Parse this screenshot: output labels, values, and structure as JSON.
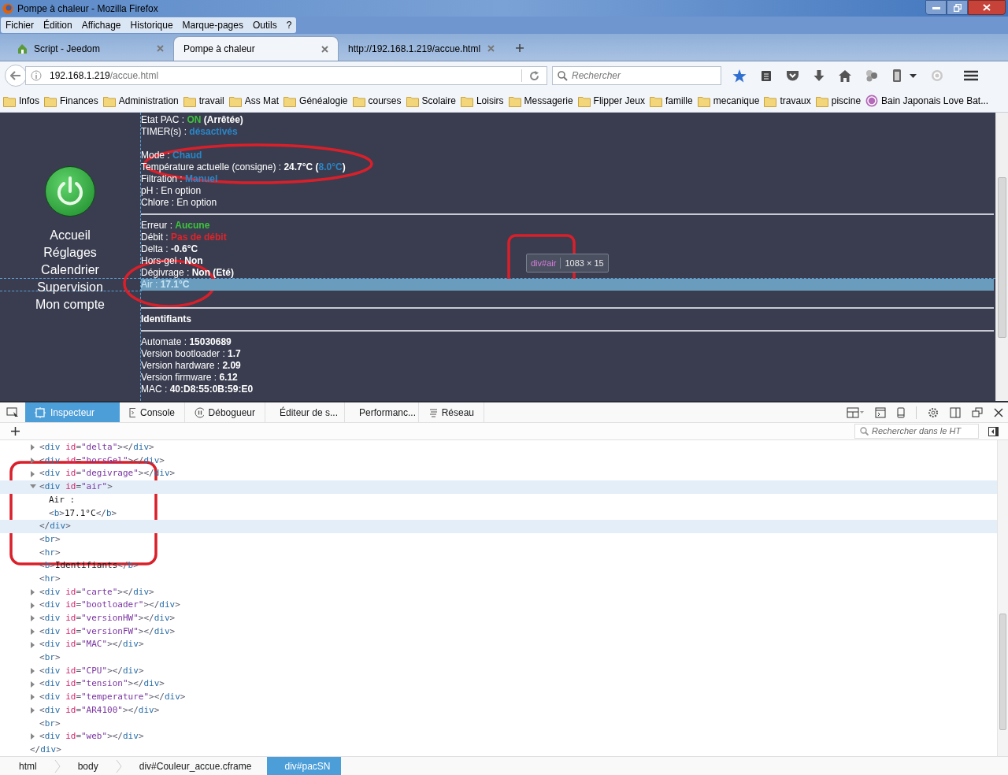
{
  "window": {
    "title": "Pompe à chaleur - Mozilla Firefox"
  },
  "menu": [
    "Fichier",
    "Édition",
    "Affichage",
    "Historique",
    "Marque-pages",
    "Outils",
    "?"
  ],
  "tabs": [
    {
      "label": "Script - Jeedom",
      "selected": false
    },
    {
      "label": "Pompe à chaleur",
      "selected": true
    },
    {
      "label": "http://192.168.1.219/accue.html",
      "selected": false
    }
  ],
  "address": {
    "host": "192.168.1.219",
    "path": "/accue.html"
  },
  "search": {
    "placeholder": "Rechercher"
  },
  "bookmarks": [
    {
      "label": "Infos",
      "kind": "folder"
    },
    {
      "label": "Finances",
      "kind": "folder"
    },
    {
      "label": "Administration",
      "kind": "folder"
    },
    {
      "label": "travail",
      "kind": "folder"
    },
    {
      "label": "Ass Mat",
      "kind": "folder"
    },
    {
      "label": "Généalogie",
      "kind": "folder"
    },
    {
      "label": "courses",
      "kind": "folder"
    },
    {
      "label": "Scolaire",
      "kind": "folder"
    },
    {
      "label": "Loisirs",
      "kind": "folder"
    },
    {
      "label": "Messagerie",
      "kind": "folder"
    },
    {
      "label": "Flipper Jeux",
      "kind": "folder"
    },
    {
      "label": "famille",
      "kind": "folder"
    },
    {
      "label": "mecanique",
      "kind": "folder"
    },
    {
      "label": "travaux",
      "kind": "folder"
    },
    {
      "label": "piscine",
      "kind": "folder"
    },
    {
      "label": "Bain Japonais Love Bat...",
      "kind": "site"
    }
  ],
  "page": {
    "nav": [
      "Accueil",
      "Réglages",
      "Calendrier",
      "Supervision",
      "Mon compte"
    ],
    "sections": [
      {
        "lines": [
          {
            "parts": [
              {
                "text": "Etat PAC : ",
                "kind": "plain"
              },
              {
                "text": "ON",
                "kind": "green"
              },
              {
                "text": " (Arrêtée)",
                "kind": "bold"
              }
            ]
          },
          {
            "parts": [
              {
                "text": "TIMER(s) : ",
                "kind": "plain"
              },
              {
                "text": "désactivés",
                "kind": "blue"
              }
            ]
          },
          {
            "gap_before": true,
            "parts": [
              {
                "text": "Mode : ",
                "kind": "plain"
              },
              {
                "text": "Chaud",
                "kind": "blue"
              }
            ]
          },
          {
            "parts": [
              {
                "text": "Température actuelle (consigne) : ",
                "kind": "plain"
              },
              {
                "text": "24.7°C (",
                "kind": "bold"
              },
              {
                "text": "8.0°C",
                "kind": "blue"
              },
              {
                "text": ")",
                "kind": "bold"
              }
            ]
          },
          {
            "parts": [
              {
                "text": "Filtration : ",
                "kind": "plain"
              },
              {
                "text": "Manuel",
                "kind": "blue"
              }
            ]
          },
          {
            "parts": [
              {
                "text": "pH : En option",
                "kind": "plain"
              }
            ]
          },
          {
            "parts": [
              {
                "text": "Chlore : En option",
                "kind": "plain"
              }
            ]
          }
        ]
      },
      {
        "lines": [
          {
            "highlighted": false,
            "parts": [
              {
                "text": "Erreur : ",
                "kind": "plain"
              },
              {
                "text": "Aucune",
                "kind": "green"
              }
            ]
          },
          {
            "highlighted": false,
            "parts": [
              {
                "text": "Débit : ",
                "kind": "plain"
              },
              {
                "text": "Pas de débit",
                "kind": "red"
              }
            ]
          },
          {
            "highlighted": false,
            "parts": [
              {
                "text": "Delta : ",
                "kind": "plain"
              },
              {
                "text": "-0.6°C",
                "kind": "bold"
              }
            ]
          },
          {
            "highlighted": false,
            "parts": [
              {
                "text": "Hors-gel : ",
                "kind": "plain"
              },
              {
                "text": "Non",
                "kind": "bold"
              }
            ]
          },
          {
            "highlighted": false,
            "parts": [
              {
                "text": "Dégivrage : ",
                "kind": "plain"
              },
              {
                "text": "Non (Eté)",
                "kind": "bold"
              }
            ]
          },
          {
            "highlighted": true,
            "parts": [
              {
                "text": "Air : ",
                "kind": "plain"
              },
              {
                "text": "17.1°C",
                "kind": "bold"
              }
            ]
          }
        ]
      },
      {
        "heading": "Identifiants"
      },
      {
        "lines": [
          {
            "parts": [
              {
                "text": "Automate : ",
                "kind": "plain"
              },
              {
                "text": "15030689",
                "kind": "bold"
              }
            ]
          },
          {
            "parts": [
              {
                "text": "Version bootloader : ",
                "kind": "plain"
              },
              {
                "text": "1.7",
                "kind": "bold"
              }
            ]
          },
          {
            "parts": [
              {
                "text": "Version hardware : ",
                "kind": "plain"
              },
              {
                "text": "2.09",
                "kind": "bold"
              }
            ]
          },
          {
            "parts": [
              {
                "text": "Version firmware : ",
                "kind": "plain"
              },
              {
                "text": "6.12",
                "kind": "bold"
              }
            ]
          },
          {
            "parts": [
              {
                "text": "MAC : ",
                "kind": "plain"
              },
              {
                "text": "40:D8:55:0B:59:E0",
                "kind": "bold"
              }
            ]
          }
        ]
      }
    ],
    "tooltip": {
      "selector": "div#air",
      "size": "1083 × 15"
    }
  },
  "devtools": {
    "tabs": [
      {
        "label": "Inspecteur",
        "selected": true
      },
      {
        "label": "Console",
        "selected": false
      },
      {
        "label": "Débogueur",
        "selected": false
      },
      {
        "label": "Éditeur de s...",
        "selected": false
      },
      {
        "label": "Performanc...",
        "selected": false
      },
      {
        "label": "Réseau",
        "selected": false
      }
    ],
    "search": {
      "placeholder": "Rechercher dans le HT"
    },
    "nodes": [
      {
        "markup": "<div id=\"delta\"></div>",
        "expandable": true
      },
      {
        "markup": "<div id=\"horsGel\"></div>",
        "expandable": true
      },
      {
        "markup": "<div id=\"degivrage\"></div>",
        "expandable": true
      },
      {
        "markup": "<div id=\"air\">",
        "expandable": true,
        "expanded": true,
        "selected": true,
        "closing": "</div>",
        "children": [
          {
            "markup": "Air :"
          },
          {
            "markup": "<b>17.1°C</b>"
          }
        ]
      },
      {
        "markup": "<br>"
      },
      {
        "markup": "<hr>"
      },
      {
        "markup": "<b>Identifiants</b>"
      },
      {
        "markup": "<hr>"
      },
      {
        "markup": "<div id=\"carte\"></div>",
        "expandable": true
      },
      {
        "markup": "<div id=\"bootloader\"></div>",
        "expandable": true
      },
      {
        "markup": "<div id=\"versionHW\"></div>",
        "expandable": true
      },
      {
        "markup": "<div id=\"versionFW\"></div>",
        "expandable": true
      },
      {
        "markup": "<div id=\"MAC\"></div>",
        "expandable": true
      },
      {
        "markup": "<br>"
      },
      {
        "markup": "<div id=\"CPU\"></div>",
        "expandable": true
      },
      {
        "markup": "<div id=\"tension\"></div>",
        "expandable": true
      },
      {
        "markup": "<div id=\"temperature\"></div>",
        "expandable": true
      },
      {
        "markup": "<div id=\"AR4100\"></div>",
        "expandable": true
      },
      {
        "markup": "<br>"
      },
      {
        "markup": "<div id=\"web\"></div>",
        "expandable": true
      }
    ],
    "closing": "</div>",
    "breadcrumbs": [
      {
        "label": "html",
        "selected": false
      },
      {
        "label": "body",
        "selected": false
      },
      {
        "label": "div#Couleur_accue.cframe",
        "selected": false
      },
      {
        "label": "div#pacSN",
        "selected": true
      }
    ]
  }
}
